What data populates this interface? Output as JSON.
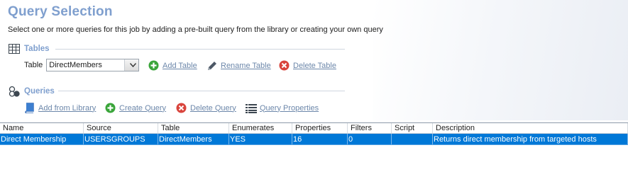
{
  "header": {
    "title": "Query Selection",
    "subtitle": "Select one or more queries for this job by adding a pre-built query from the library or creating your own query"
  },
  "tables_section": {
    "title": "Tables",
    "table_label": "Table",
    "table_select_value": "DirectMembers",
    "add_label": "Add Table",
    "rename_label": "Rename Table",
    "delete_label": "Delete Table"
  },
  "queries_section": {
    "title": "Queries",
    "add_from_library_label": "Add from Library",
    "create_label": "Create Query",
    "delete_label": "Delete Query",
    "properties_label": "Query Properties"
  },
  "grid": {
    "columns": [
      "Name",
      "Source",
      "Table",
      "Enumerates",
      "Properties",
      "Filters",
      "Script",
      "Description"
    ],
    "rows": [
      [
        "Direct Membership",
        "USERSGROUPS",
        "DirectMembers",
        "YES",
        "16",
        "0",
        "",
        "Returns direct membership from targeted hosts"
      ]
    ]
  },
  "colors": {
    "accent": "#7f9fce",
    "link": "#6c87aa",
    "selection": "#0078d7",
    "add_green": "#3aa53a",
    "delete_red": "#d9443c"
  }
}
